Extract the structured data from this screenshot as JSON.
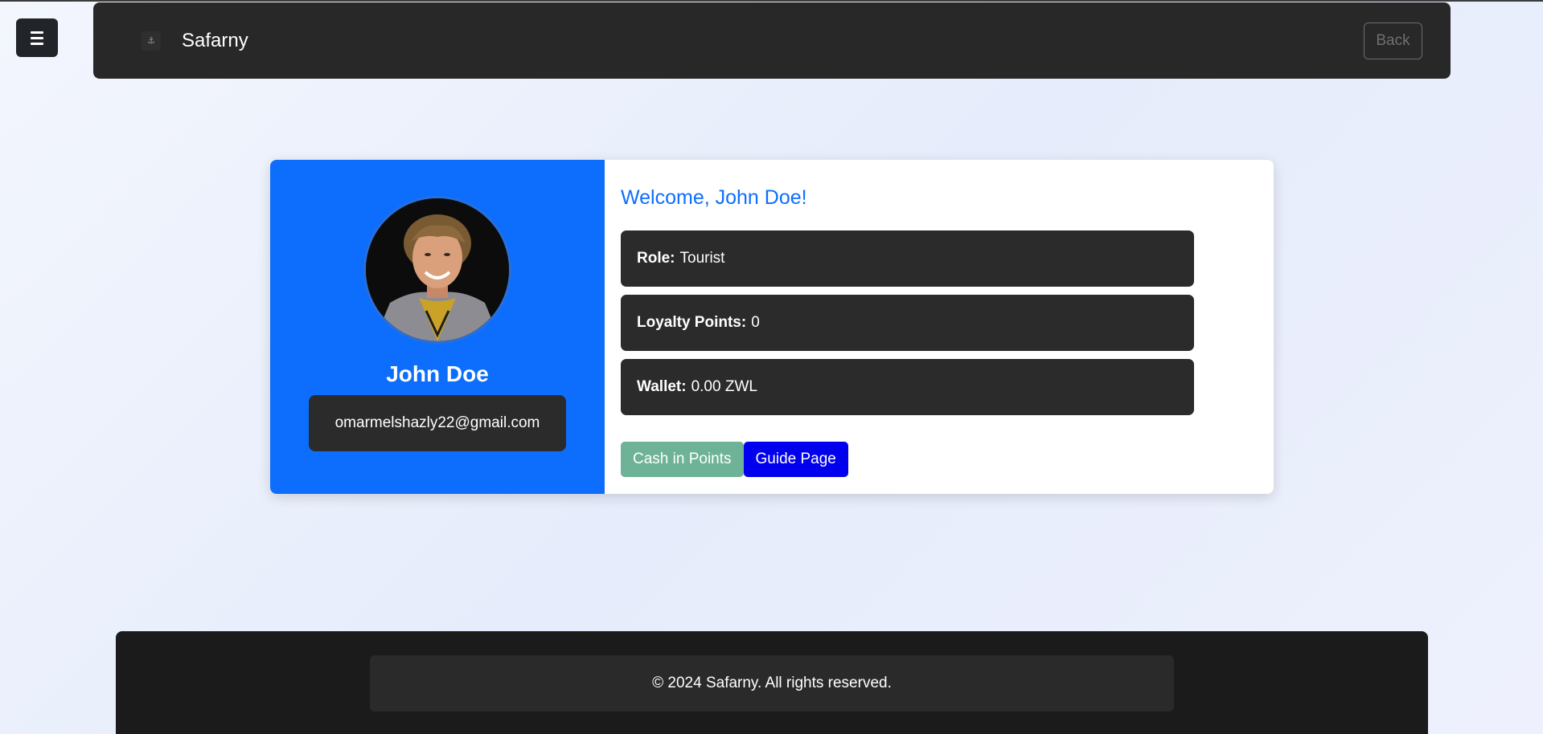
{
  "menu": {
    "icon": "hamburger-icon"
  },
  "navbar": {
    "brand_icon": "logo-icon",
    "brand_glyph": "⚓",
    "brand_name": "Safarny",
    "back_label": "Back"
  },
  "profile": {
    "avatar_icon": "user-photo",
    "name": "John Doe",
    "email": "omarmelshazly22@gmail.com"
  },
  "details": {
    "welcome": "Welcome, John Doe!",
    "role_label": "Role:",
    "role_value": "Tourist",
    "loyalty_label": "Loyalty Points:",
    "loyalty_value": "0",
    "wallet_label": "Wallet:",
    "wallet_value": "0.00 ZWL"
  },
  "actions": {
    "cash_label": "Cash in Points",
    "guide_label": "Guide Page"
  },
  "footer": {
    "text": "© 2024 Safarny. All rights reserved."
  },
  "colors": {
    "primary": "#0d6efd",
    "dark": "#2b2b2b",
    "cash_button": "#6eb397",
    "guide_button": "#0000ee"
  }
}
